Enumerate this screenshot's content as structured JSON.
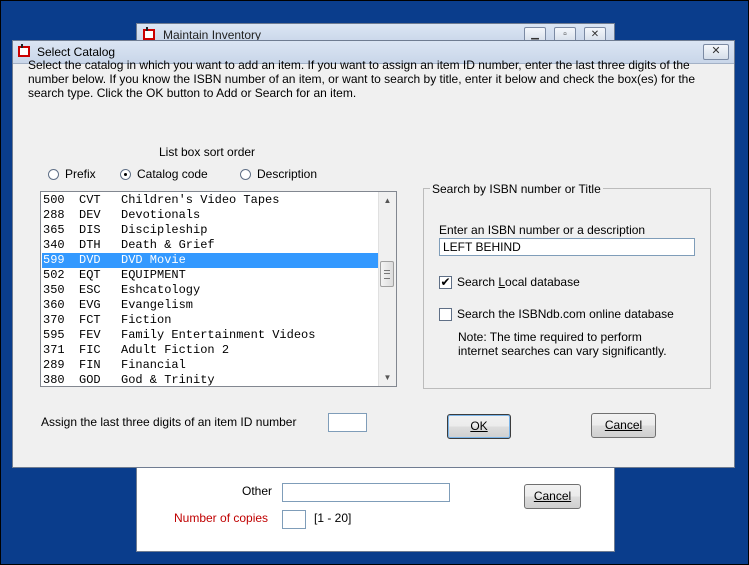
{
  "background_window": {
    "title": "Maintain Inventory",
    "other_label": "Other",
    "copies_label": "Number of copies",
    "copies_range": "[1 - 20]",
    "cancel_label": "Cancel",
    "label_color": "#c00000"
  },
  "dialog": {
    "title": "Select Catalog",
    "close_glyph": "✕",
    "instructions": "Select the catalog in which you want to add an item.  If you want to assign an item ID number, enter the last three digits of the number below.  If you know the ISBN number of an item, or want to search by title, enter it below and check the box(es) for the search type.  Click the OK button to Add or Search for an item.",
    "sort_order_label": "List box sort order",
    "sort_options": [
      {
        "label": "Prefix",
        "selected": false
      },
      {
        "label": "Catalog code",
        "selected": true
      },
      {
        "label": "Description",
        "selected": false
      }
    ],
    "catalog_list": [
      {
        "code": "500",
        "abbr": "CVT",
        "desc": "Children's Video Tapes"
      },
      {
        "code": "288",
        "abbr": "DEV",
        "desc": "Devotionals"
      },
      {
        "code": "365",
        "abbr": "DIS",
        "desc": "Discipleship"
      },
      {
        "code": "340",
        "abbr": "DTH",
        "desc": "Death & Grief"
      },
      {
        "code": "599",
        "abbr": "DVD",
        "desc": "DVD Movie",
        "selected": true
      },
      {
        "code": "502",
        "abbr": "EQT",
        "desc": "EQUIPMENT"
      },
      {
        "code": "350",
        "abbr": "ESC",
        "desc": "Eshcatology"
      },
      {
        "code": "360",
        "abbr": "EVG",
        "desc": "Evangelism"
      },
      {
        "code": "370",
        "abbr": "FCT",
        "desc": "Fiction"
      },
      {
        "code": "595",
        "abbr": "FEV",
        "desc": "Family Entertainment Videos"
      },
      {
        "code": "371",
        "abbr": "FIC",
        "desc": "Adult Fiction 2"
      },
      {
        "code": "289",
        "abbr": "FIN",
        "desc": "Financial"
      },
      {
        "code": "380",
        "abbr": "GOD",
        "desc": "God & Trinity"
      }
    ],
    "isbn_group": {
      "title": "Search by ISBN number or Title",
      "input_label": "Enter an ISBN number or a description",
      "input_value": "LEFT BEHIND",
      "search_local_label": "Search Local database",
      "search_local_checked": true,
      "search_online_label": "Search the ISBNdb.com online database",
      "search_online_checked": false,
      "note_line1": "Note: The time required to perform",
      "note_line2": "internet searches can vary significantly."
    },
    "assign_id_label": "Assign the last three digits of an item ID number",
    "assign_id_value": "",
    "ok_label": "OK",
    "cancel_label": "Cancel",
    "selection_color": "#3399ff"
  }
}
